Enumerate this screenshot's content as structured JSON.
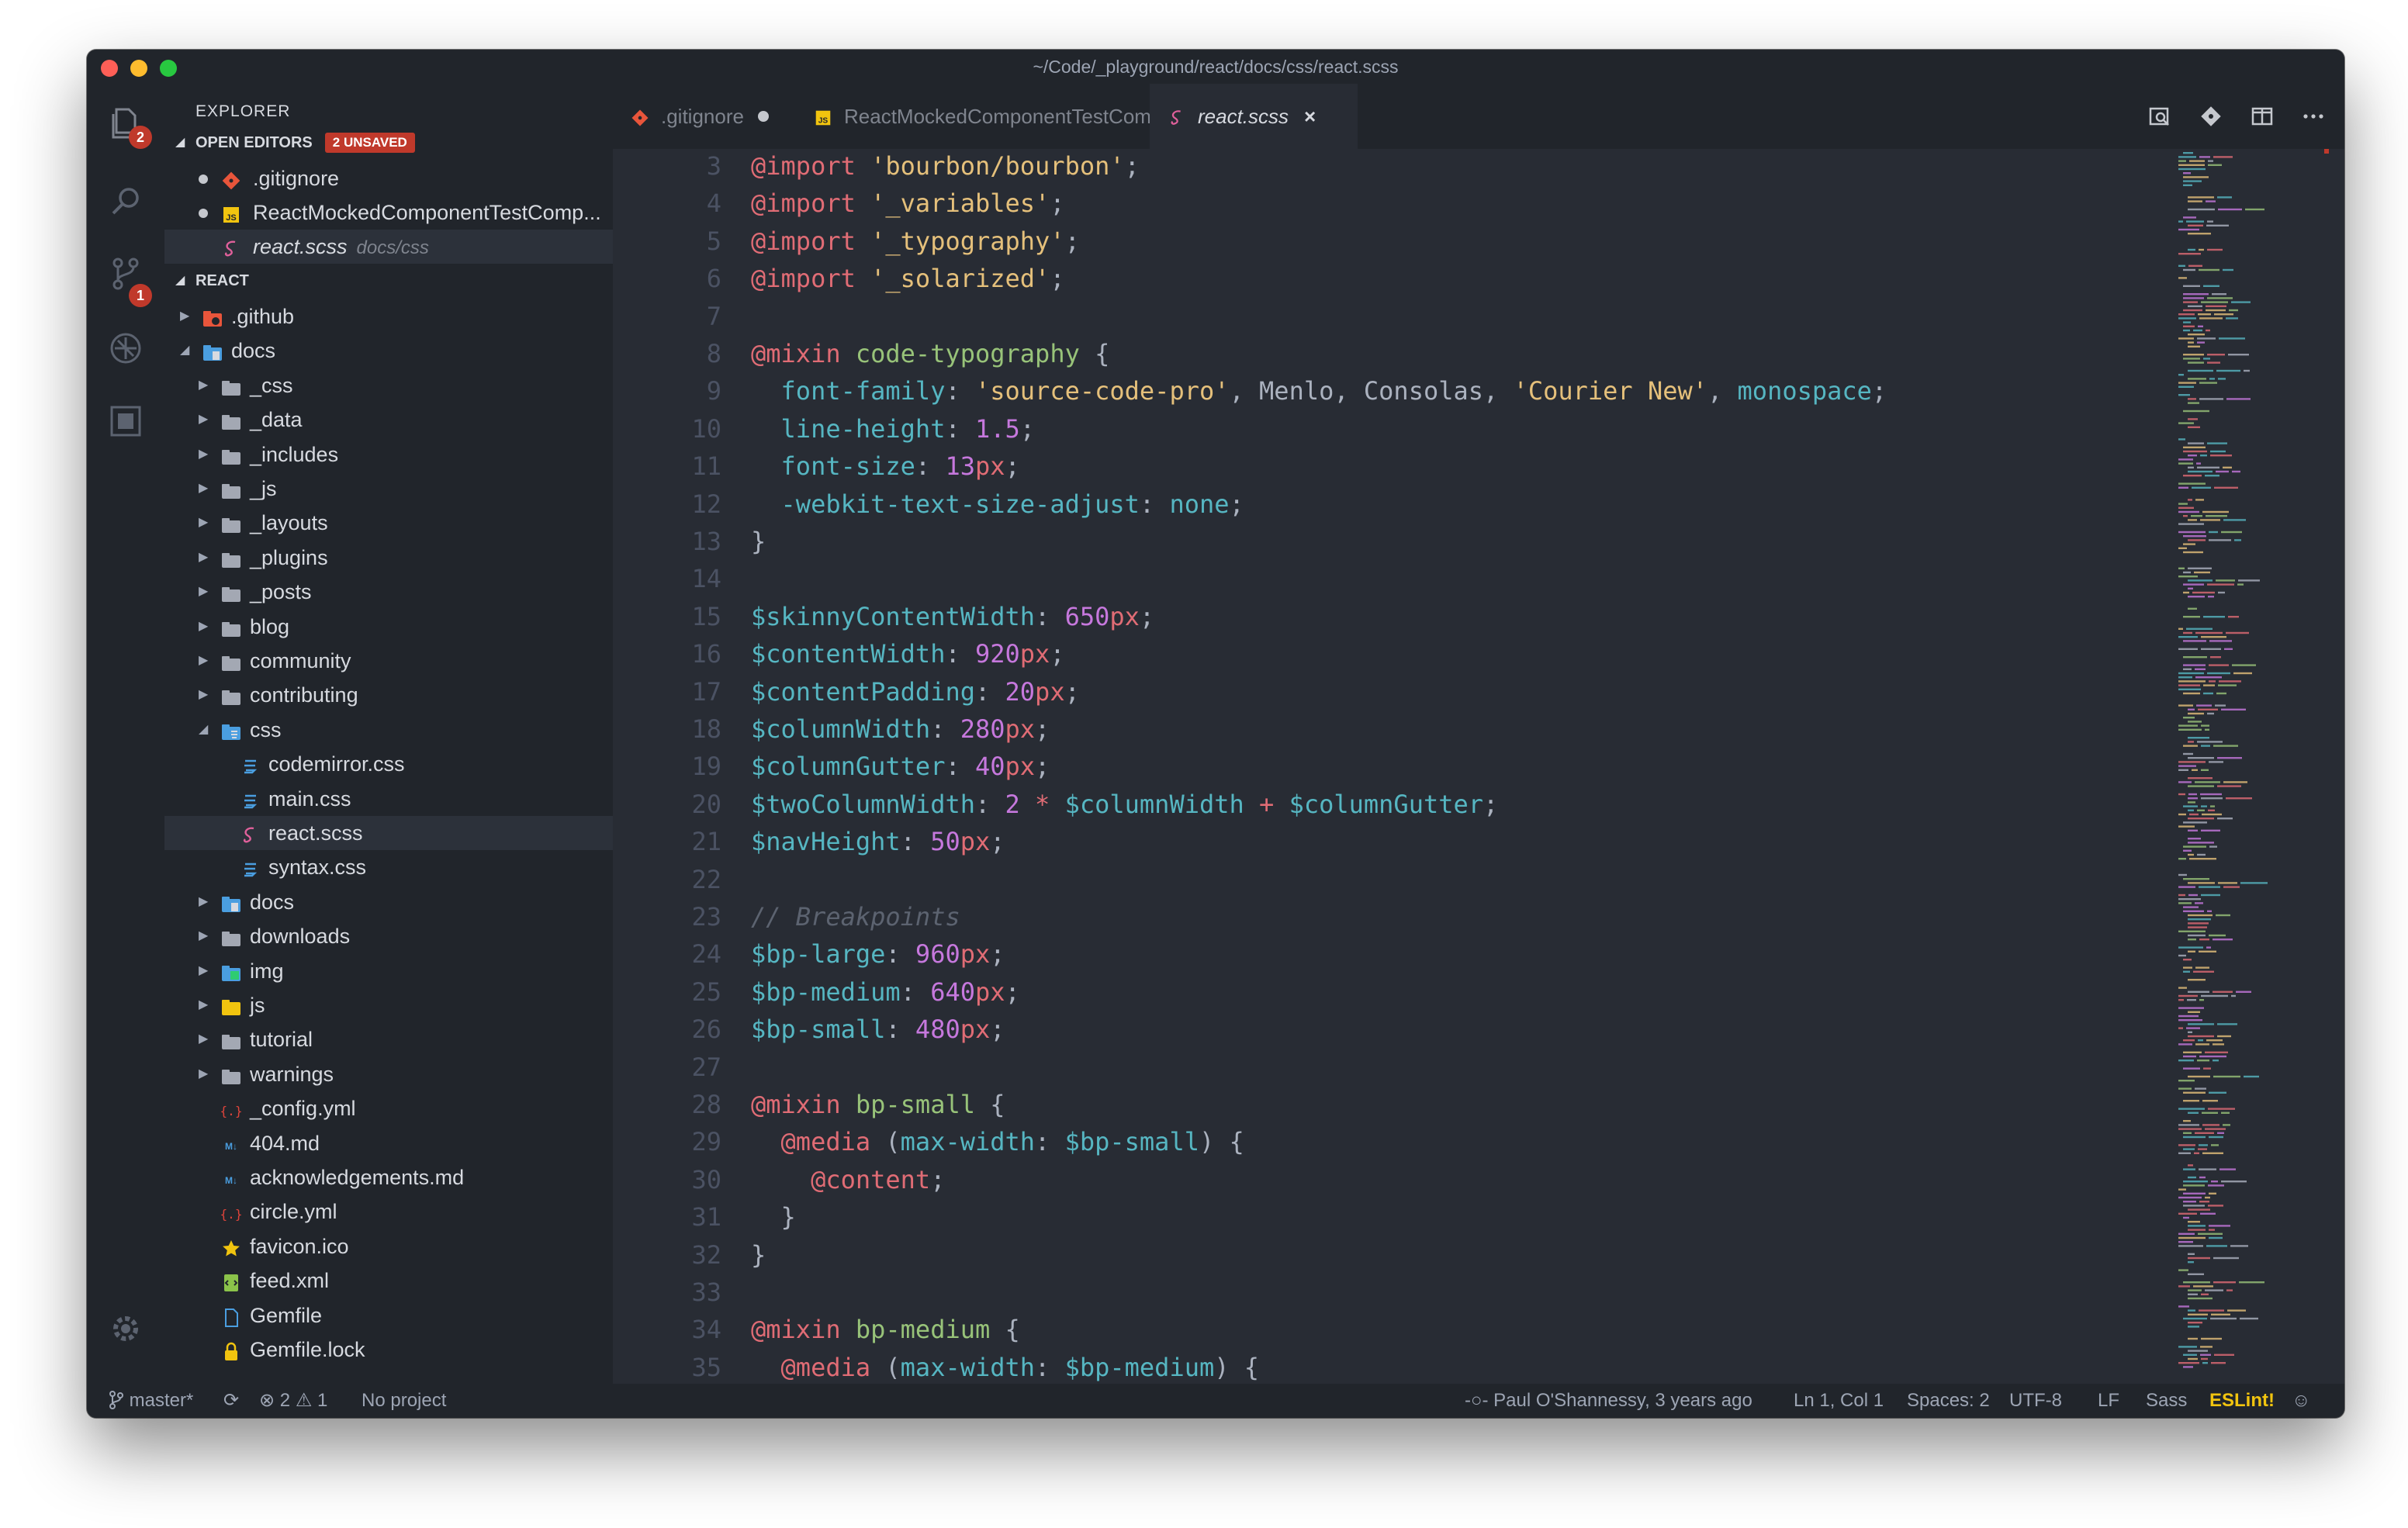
{
  "window": {
    "title": "~/Code/_playground/react/docs/css/react.scss"
  },
  "activity_bar": {
    "explorer_badge": "2",
    "scm_badge": "1"
  },
  "sidebar": {
    "title": "EXPLORER",
    "open_editors": {
      "label": "OPEN EDITORS",
      "badge": "2 UNSAVED",
      "items": [
        {
          "name": ".gitignore",
          "icon": "git-icon",
          "dirty": true
        },
        {
          "name": "ReactMockedComponentTestComp...",
          "icon": "js-icon",
          "dirty": true
        },
        {
          "name": "react.scss",
          "path": "docs/css",
          "icon": "sass-icon",
          "dirty": false
        }
      ]
    },
    "project": {
      "label": "REACT",
      "tree": [
        {
          "name": ".github",
          "depth": 0,
          "type": "folder",
          "expanded": false,
          "icon": "github-folder-icon"
        },
        {
          "name": "docs",
          "depth": 0,
          "type": "folder",
          "expanded": true,
          "icon": "docs-folder-icon"
        },
        {
          "name": "_css",
          "depth": 1,
          "type": "folder",
          "expanded": false
        },
        {
          "name": "_data",
          "depth": 1,
          "type": "folder",
          "expanded": false
        },
        {
          "name": "_includes",
          "depth": 1,
          "type": "folder",
          "expanded": false
        },
        {
          "name": "_js",
          "depth": 1,
          "type": "folder",
          "expanded": false
        },
        {
          "name": "_layouts",
          "depth": 1,
          "type": "folder",
          "expanded": false
        },
        {
          "name": "_plugins",
          "depth": 1,
          "type": "folder",
          "expanded": false
        },
        {
          "name": "_posts",
          "depth": 1,
          "type": "folder",
          "expanded": false
        },
        {
          "name": "blog",
          "depth": 1,
          "type": "folder",
          "expanded": false
        },
        {
          "name": "community",
          "depth": 1,
          "type": "folder",
          "expanded": false
        },
        {
          "name": "contributing",
          "depth": 1,
          "type": "folder",
          "expanded": false
        },
        {
          "name": "css",
          "depth": 1,
          "type": "folder",
          "expanded": true,
          "icon": "css-folder-icon"
        },
        {
          "name": "codemirror.css",
          "depth": 2,
          "type": "file",
          "icon": "css-icon"
        },
        {
          "name": "main.css",
          "depth": 2,
          "type": "file",
          "icon": "css-icon"
        },
        {
          "name": "react.scss",
          "depth": 2,
          "type": "file",
          "icon": "sass-icon",
          "selected": true
        },
        {
          "name": "syntax.css",
          "depth": 2,
          "type": "file",
          "icon": "css-icon"
        },
        {
          "name": "docs",
          "depth": 1,
          "type": "folder",
          "expanded": false,
          "icon": "docs-folder-icon"
        },
        {
          "name": "downloads",
          "depth": 1,
          "type": "folder",
          "expanded": false
        },
        {
          "name": "img",
          "depth": 1,
          "type": "folder",
          "expanded": false,
          "icon": "img-folder-icon"
        },
        {
          "name": "js",
          "depth": 1,
          "type": "folder",
          "expanded": false,
          "icon": "js-folder-icon"
        },
        {
          "name": "tutorial",
          "depth": 1,
          "type": "folder",
          "expanded": false
        },
        {
          "name": "warnings",
          "depth": 1,
          "type": "folder",
          "expanded": false
        },
        {
          "name": "_config.yml",
          "depth": 1,
          "type": "file",
          "icon": "yaml-icon"
        },
        {
          "name": "404.md",
          "depth": 1,
          "type": "file",
          "icon": "markdown-icon"
        },
        {
          "name": "acknowledgements.md",
          "depth": 1,
          "type": "file",
          "icon": "markdown-icon"
        },
        {
          "name": "circle.yml",
          "depth": 1,
          "type": "file",
          "icon": "yaml-icon"
        },
        {
          "name": "favicon.ico",
          "depth": 1,
          "type": "file",
          "icon": "star-icon"
        },
        {
          "name": "feed.xml",
          "depth": 1,
          "type": "file",
          "icon": "xml-icon"
        },
        {
          "name": "Gemfile",
          "depth": 1,
          "type": "file",
          "icon": "file-icon"
        },
        {
          "name": "Gemfile.lock",
          "depth": 1,
          "type": "file",
          "icon": "lock-icon"
        }
      ]
    }
  },
  "tabs": [
    {
      "label": ".gitignore",
      "icon": "git-icon",
      "dirty": true,
      "active": false
    },
    {
      "label": "ReactMockedComponentTestComponent.js",
      "icon": "js-icon",
      "dirty": true,
      "active": false
    },
    {
      "label": "react.scss",
      "icon": "sass-icon",
      "dirty": false,
      "active": true,
      "close": "×"
    }
  ],
  "editor": {
    "lines": [
      {
        "n": "3",
        "tokens": [
          [
            "at",
            "@import"
          ],
          [
            "plain",
            " "
          ],
          [
            "str",
            "'bourbon/bourbon'"
          ],
          [
            "plain",
            ";"
          ]
        ]
      },
      {
        "n": "4",
        "tokens": [
          [
            "at",
            "@import"
          ],
          [
            "plain",
            " "
          ],
          [
            "str",
            "'_variables'"
          ],
          [
            "plain",
            ";"
          ]
        ]
      },
      {
        "n": "5",
        "tokens": [
          [
            "at",
            "@import"
          ],
          [
            "plain",
            " "
          ],
          [
            "str",
            "'_typography'"
          ],
          [
            "plain",
            ";"
          ]
        ]
      },
      {
        "n": "6",
        "tokens": [
          [
            "at",
            "@import"
          ],
          [
            "plain",
            " "
          ],
          [
            "str",
            "'_solarized'"
          ],
          [
            "plain",
            ";"
          ]
        ]
      },
      {
        "n": "7",
        "tokens": []
      },
      {
        "n": "8",
        "tokens": [
          [
            "at",
            "@mixin"
          ],
          [
            "plain",
            " "
          ],
          [
            "fn",
            "code-typography"
          ],
          [
            "plain",
            " {"
          ]
        ]
      },
      {
        "n": "9",
        "tokens": [
          [
            "plain",
            "  "
          ],
          [
            "prop",
            "font-family"
          ],
          [
            "plain",
            ": "
          ],
          [
            "str",
            "'source-code-pro'"
          ],
          [
            "plain",
            ", Menlo, Consolas, "
          ],
          [
            "str",
            "'Courier New'"
          ],
          [
            "plain",
            ", "
          ],
          [
            "prop",
            "monospace"
          ],
          [
            "plain",
            ";"
          ]
        ]
      },
      {
        "n": "10",
        "tokens": [
          [
            "plain",
            "  "
          ],
          [
            "prop",
            "line-height"
          ],
          [
            "plain",
            ": "
          ],
          [
            "num",
            "1.5"
          ],
          [
            "plain",
            ";"
          ]
        ]
      },
      {
        "n": "11",
        "tokens": [
          [
            "plain",
            "  "
          ],
          [
            "prop",
            "font-size"
          ],
          [
            "plain",
            ": "
          ],
          [
            "num",
            "13"
          ],
          [
            "unit",
            "px"
          ],
          [
            "plain",
            ";"
          ]
        ]
      },
      {
        "n": "12",
        "tokens": [
          [
            "plain",
            "  "
          ],
          [
            "prop",
            "-webkit-text-size-adjust"
          ],
          [
            "plain",
            ": "
          ],
          [
            "prop",
            "none"
          ],
          [
            "plain",
            ";"
          ]
        ]
      },
      {
        "n": "13",
        "tokens": [
          [
            "plain",
            "}"
          ]
        ]
      },
      {
        "n": "14",
        "tokens": []
      },
      {
        "n": "15",
        "tokens": [
          [
            "var",
            "$skinnyContentWidth"
          ],
          [
            "plain",
            ": "
          ],
          [
            "num",
            "650"
          ],
          [
            "unit",
            "px"
          ],
          [
            "plain",
            ";"
          ]
        ]
      },
      {
        "n": "16",
        "tokens": [
          [
            "var",
            "$contentWidth"
          ],
          [
            "plain",
            ": "
          ],
          [
            "num",
            "920"
          ],
          [
            "unit",
            "px"
          ],
          [
            "plain",
            ";"
          ]
        ]
      },
      {
        "n": "17",
        "tokens": [
          [
            "var",
            "$contentPadding"
          ],
          [
            "plain",
            ": "
          ],
          [
            "num",
            "20"
          ],
          [
            "unit",
            "px"
          ],
          [
            "plain",
            ";"
          ]
        ]
      },
      {
        "n": "18",
        "tokens": [
          [
            "var",
            "$columnWidth"
          ],
          [
            "plain",
            ": "
          ],
          [
            "num",
            "280"
          ],
          [
            "unit",
            "px"
          ],
          [
            "plain",
            ";"
          ]
        ]
      },
      {
        "n": "19",
        "tokens": [
          [
            "var",
            "$columnGutter"
          ],
          [
            "plain",
            ": "
          ],
          [
            "num",
            "40"
          ],
          [
            "unit",
            "px"
          ],
          [
            "plain",
            ";"
          ]
        ]
      },
      {
        "n": "20",
        "tokens": [
          [
            "var",
            "$twoColumnWidth"
          ],
          [
            "plain",
            ": "
          ],
          [
            "num",
            "2"
          ],
          [
            "plain",
            " "
          ],
          [
            "op",
            "*"
          ],
          [
            "plain",
            " "
          ],
          [
            "var",
            "$columnWidth"
          ],
          [
            "plain",
            " "
          ],
          [
            "op",
            "+"
          ],
          [
            "plain",
            " "
          ],
          [
            "var",
            "$columnGutter"
          ],
          [
            "plain",
            ";"
          ]
        ]
      },
      {
        "n": "21",
        "tokens": [
          [
            "var",
            "$navHeight"
          ],
          [
            "plain",
            ": "
          ],
          [
            "num",
            "50"
          ],
          [
            "unit",
            "px"
          ],
          [
            "plain",
            ";"
          ]
        ]
      },
      {
        "n": "22",
        "tokens": []
      },
      {
        "n": "23",
        "tokens": [
          [
            "cm",
            "// Breakpoints"
          ]
        ]
      },
      {
        "n": "24",
        "tokens": [
          [
            "var",
            "$bp-large"
          ],
          [
            "plain",
            ": "
          ],
          [
            "num",
            "960"
          ],
          [
            "unit",
            "px"
          ],
          [
            "plain",
            ";"
          ]
        ]
      },
      {
        "n": "25",
        "tokens": [
          [
            "var",
            "$bp-medium"
          ],
          [
            "plain",
            ": "
          ],
          [
            "num",
            "640"
          ],
          [
            "unit",
            "px"
          ],
          [
            "plain",
            ";"
          ]
        ]
      },
      {
        "n": "26",
        "tokens": [
          [
            "var",
            "$bp-small"
          ],
          [
            "plain",
            ": "
          ],
          [
            "num",
            "480"
          ],
          [
            "unit",
            "px"
          ],
          [
            "plain",
            ";"
          ]
        ]
      },
      {
        "n": "27",
        "tokens": []
      },
      {
        "n": "28",
        "tokens": [
          [
            "at",
            "@mixin"
          ],
          [
            "plain",
            " "
          ],
          [
            "fn",
            "bp-small"
          ],
          [
            "plain",
            " {"
          ]
        ]
      },
      {
        "n": "29",
        "tokens": [
          [
            "plain",
            "  "
          ],
          [
            "at",
            "@media"
          ],
          [
            "plain",
            " ("
          ],
          [
            "prop",
            "max-width"
          ],
          [
            "plain",
            ": "
          ],
          [
            "var",
            "$bp-small"
          ],
          [
            "plain",
            ") {"
          ]
        ]
      },
      {
        "n": "30",
        "tokens": [
          [
            "plain",
            "    "
          ],
          [
            "at",
            "@content"
          ],
          [
            "plain",
            ";"
          ]
        ]
      },
      {
        "n": "31",
        "tokens": [
          [
            "plain",
            "  }"
          ]
        ]
      },
      {
        "n": "32",
        "tokens": [
          [
            "plain",
            "}"
          ]
        ]
      },
      {
        "n": "33",
        "tokens": []
      },
      {
        "n": "34",
        "tokens": [
          [
            "at",
            "@mixin"
          ],
          [
            "plain",
            " "
          ],
          [
            "fn",
            "bp-medium"
          ],
          [
            "plain",
            " {"
          ]
        ]
      },
      {
        "n": "35",
        "tokens": [
          [
            "plain",
            "  "
          ],
          [
            "at",
            "@media"
          ],
          [
            "plain",
            " ("
          ],
          [
            "prop",
            "max-width"
          ],
          [
            "plain",
            ": "
          ],
          [
            "var",
            "$bp-medium"
          ],
          [
            "plain",
            ") {"
          ]
        ]
      }
    ]
  },
  "statusbar": {
    "branch": "master*",
    "errors": "2",
    "warnings": "1",
    "project": "No project",
    "blame": "Paul O'Shannessy, 3 years ago",
    "position": "Ln 1, Col 1",
    "spaces": "Spaces: 2",
    "encoding": "UTF-8",
    "eol": "LF",
    "language": "Sass",
    "linter": "ESLint!"
  },
  "colors": {
    "background": "#282c34",
    "chrome": "#21252b",
    "accent_red": "#c0392b",
    "sass_pink": "#e0609b",
    "eslint_yellow": "#f1c40f"
  }
}
